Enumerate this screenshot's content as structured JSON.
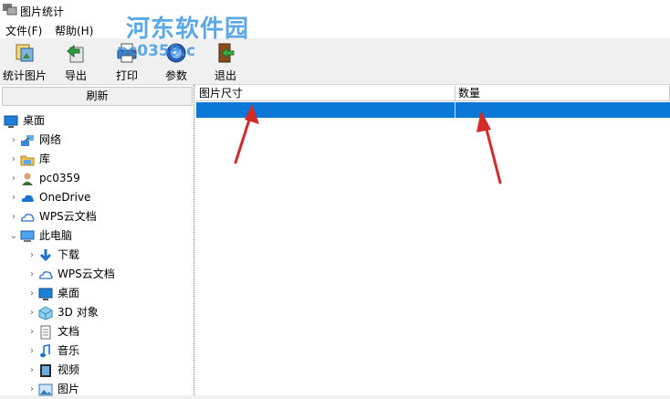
{
  "window": {
    "title": "图片统计"
  },
  "watermark": {
    "text": "河东软件园",
    "url": "pc0359.c"
  },
  "menu": [
    {
      "label": "文件(F)"
    },
    {
      "label": "帮助(H)"
    }
  ],
  "toolbar": [
    {
      "label": "统计图片",
      "icon": "count-images-icon"
    },
    {
      "label": "导出",
      "icon": "export-icon"
    },
    {
      "label": "打印",
      "icon": "print-icon"
    },
    {
      "label": "参数",
      "icon": "settings-gear-icon"
    },
    {
      "label": "退出",
      "icon": "exit-icon"
    }
  ],
  "left_pane": {
    "refresh_label": "刷新",
    "tree": [
      {
        "label": "桌面",
        "icon": "desktop-icon",
        "level": 0,
        "chevron": ""
      },
      {
        "label": "网络",
        "icon": "network-icon",
        "level": 1,
        "chevron": "›"
      },
      {
        "label": "库",
        "icon": "library-icon",
        "level": 1,
        "chevron": "›"
      },
      {
        "label": "pc0359",
        "icon": "user-icon",
        "level": 1,
        "chevron": "›"
      },
      {
        "label": "OneDrive",
        "icon": "onedrive-icon",
        "level": 1,
        "chevron": "›"
      },
      {
        "label": "WPS云文档",
        "icon": "wps-cloud-icon",
        "level": 1,
        "chevron": "›"
      },
      {
        "label": "此电脑",
        "icon": "this-pc-icon",
        "level": 1,
        "chevron": "⌄"
      },
      {
        "label": "下载",
        "icon": "download-icon",
        "level": 2,
        "chevron": "›"
      },
      {
        "label": "WPS云文档",
        "icon": "wps-cloud-icon",
        "level": 2,
        "chevron": "›"
      },
      {
        "label": "桌面",
        "icon": "desktop-icon",
        "level": 2,
        "chevron": "›"
      },
      {
        "label": "3D 对象",
        "icon": "3d-objects-icon",
        "level": 2,
        "chevron": "›"
      },
      {
        "label": "文档",
        "icon": "documents-icon",
        "level": 2,
        "chevron": "›"
      },
      {
        "label": "音乐",
        "icon": "music-icon",
        "level": 2,
        "chevron": "›"
      },
      {
        "label": "视频",
        "icon": "video-icon",
        "level": 2,
        "chevron": "›"
      },
      {
        "label": "图片",
        "icon": "pictures-icon",
        "level": 2,
        "chevron": "›"
      }
    ]
  },
  "table": {
    "columns": [
      "图片尺寸",
      "数量"
    ],
    "rows": [
      [
        "",
        ""
      ]
    ]
  },
  "colors": {
    "selection": "#0a78d7",
    "annotation_arrow": "#d42a2a",
    "watermark": "#2f8fe0"
  }
}
